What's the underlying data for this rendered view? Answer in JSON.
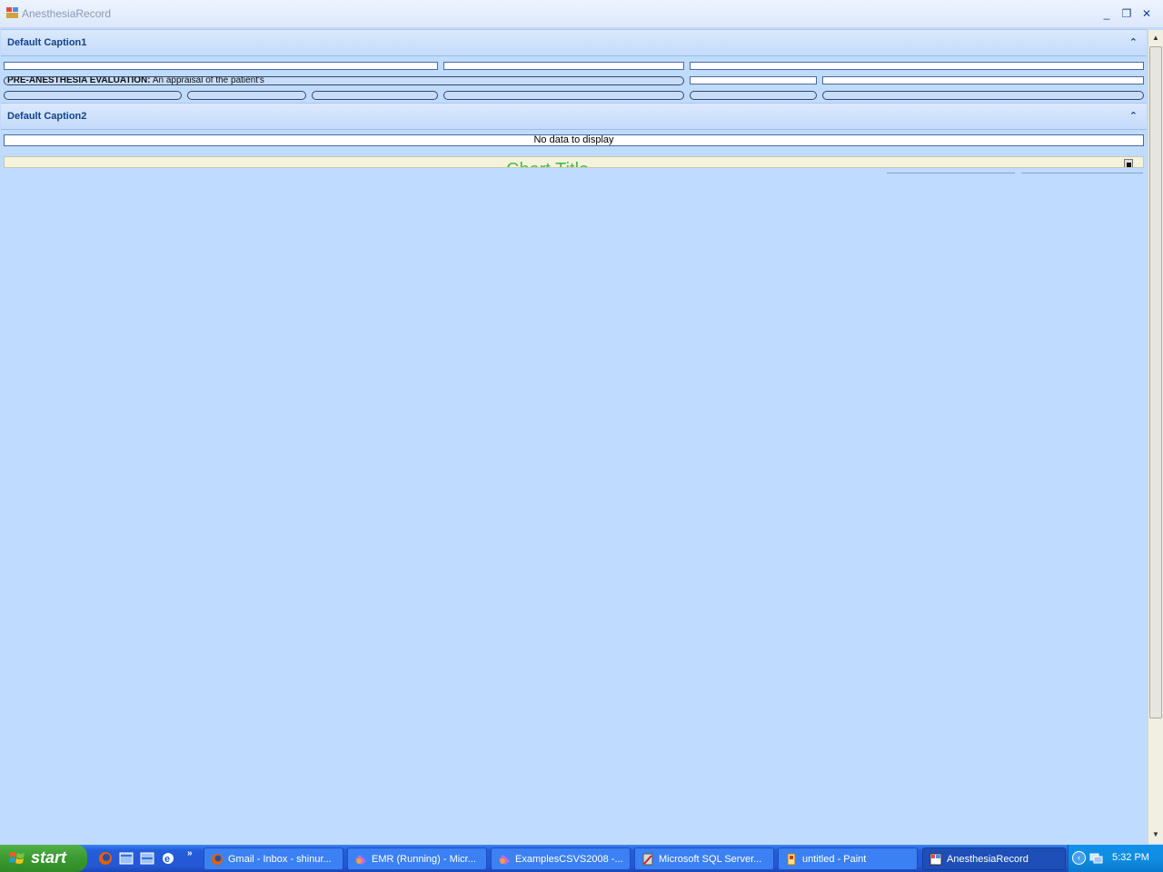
{
  "window": {
    "title": "AnesthesiaRecord",
    "controls": {
      "minimize": "_",
      "restore": "❐",
      "close": "✕"
    }
  },
  "panel1": {
    "caption": "Default Caption1",
    "collapse_glyph": "⌃",
    "evaluation_label_bold": "PRE-ANESTHESIA EVALUATION:",
    "evaluation_label_text": " An appraisal of the patient's"
  },
  "panel2": {
    "caption": "Default Caption2",
    "collapse_glyph": "⌃",
    "grid_empty_text": "No data to display",
    "chart_title": "Chart Title"
  },
  "scrollbar": {
    "up": "▲",
    "down": "▼"
  },
  "taskbar": {
    "start_label": "start",
    "overflow": "»",
    "tasks": [
      {
        "label": "Gmail - Inbox - shinur...",
        "icon": "firefox-icon"
      },
      {
        "label": "EMR (Running) - Micr...",
        "icon": "visual-studio-icon"
      },
      {
        "label": "ExamplesCSVS2008 -...",
        "icon": "visual-studio-icon"
      },
      {
        "label": "Microsoft SQL Server...",
        "icon": "sql-server-icon"
      },
      {
        "label": "untitled - Paint",
        "icon": "paint-icon"
      },
      {
        "label": "AnesthesiaRecord",
        "icon": "app-window-icon"
      }
    ],
    "clock": "5:32 PM"
  }
}
